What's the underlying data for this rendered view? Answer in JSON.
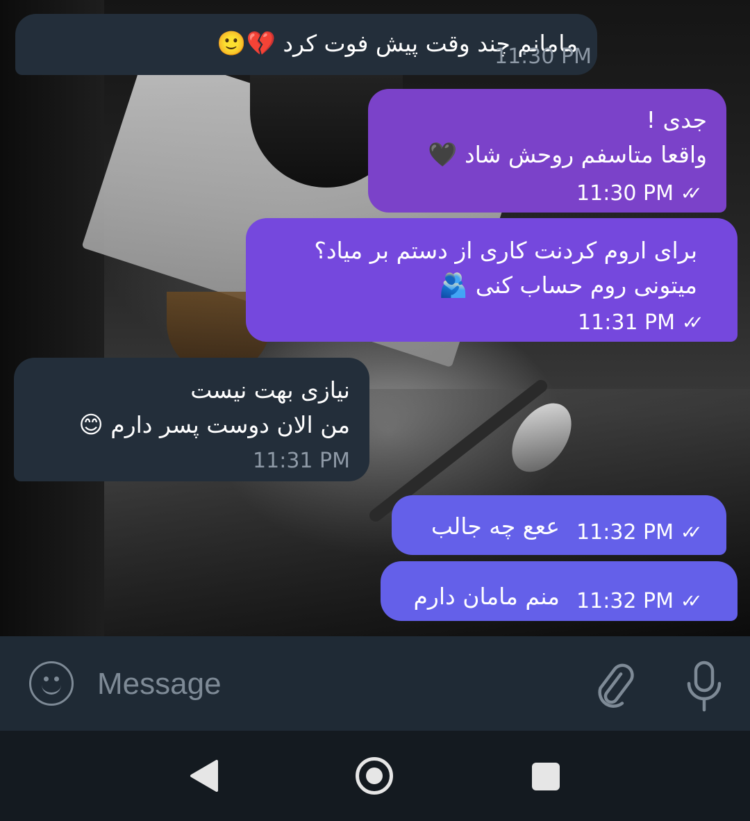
{
  "messages": [
    {
      "direction": "incoming",
      "lines": [
        "مامانم چند وقت پیش فوت کرد"
      ],
      "emojis": [
        "💔",
        "🙂"
      ],
      "time": "11:30 PM"
    },
    {
      "direction": "outgoing",
      "lines": [
        "جدی !",
        "واقعا متاسفم روحش شاد"
      ],
      "emojis": [
        "🖤"
      ],
      "time": "11:30 PM",
      "read": true
    },
    {
      "direction": "outgoing",
      "lines": [
        "برای اروم کردنت کاری از دستم بر میاد؟",
        "میتونی روم حساب کنی"
      ],
      "emojis": [
        "🫂"
      ],
      "time": "11:31 PM",
      "read": true
    },
    {
      "direction": "incoming",
      "lines": [
        "نیازی بهت نیست",
        "من الان دوست پسر دارم"
      ],
      "emojis": [
        "😊"
      ],
      "time": "11:31 PM"
    },
    {
      "direction": "outgoing",
      "lines": [
        "ععع چه جالب"
      ],
      "time": "11:32 PM",
      "read": true
    },
    {
      "direction": "outgoing",
      "lines": [
        "منم مامان دارم"
      ],
      "time": "11:32 PM",
      "read": true
    }
  ],
  "input": {
    "placeholder": "Message"
  },
  "icons": {
    "emoji": "smiley-face-icon",
    "attach": "paperclip-icon",
    "mic": "microphone-icon",
    "read_receipt": "double-check-icon",
    "nav_back": "triangle-back-icon",
    "nav_home": "circle-home-icon",
    "nav_recent": "square-recents-icon"
  },
  "colors": {
    "incoming_bubble": "#232e3a",
    "outgoing_bubble_1": "#7b42c9",
    "outgoing_bubble_2": "#7548dd",
    "outgoing_bubble_3": "#6460e9",
    "input_bar": "#1f2a35",
    "nav_bar": "#141a20"
  }
}
